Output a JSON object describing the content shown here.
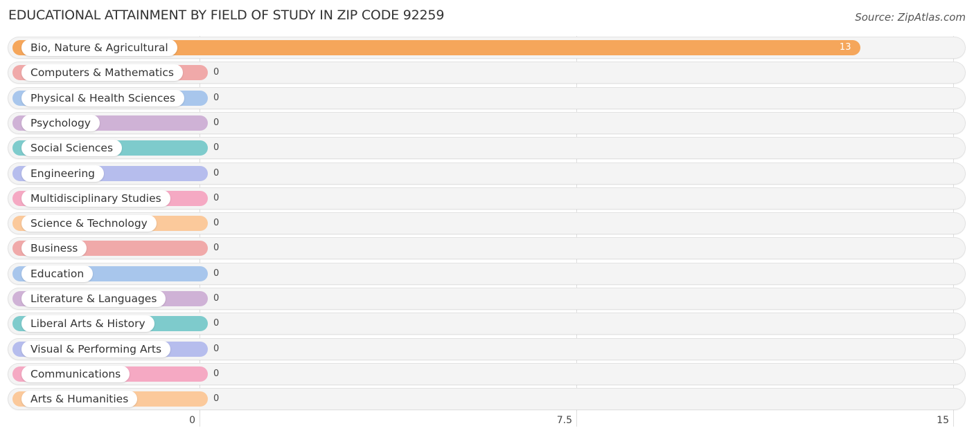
{
  "header": {
    "title": "EDUCATIONAL ATTAINMENT BY FIELD OF STUDY IN ZIP CODE 92259",
    "source": "Source: ZipAtlas.com"
  },
  "chart_data": {
    "type": "bar",
    "orientation": "horizontal",
    "title": "EDUCATIONAL ATTAINMENT BY FIELD OF STUDY IN ZIP CODE 92259",
    "xlabel": "",
    "ylabel": "",
    "xlim": [
      0,
      15
    ],
    "xticks": [
      "0",
      "7.5",
      "15"
    ],
    "xtick_values": [
      0,
      7.5,
      15
    ],
    "grid": true,
    "categories": [
      "Bio, Nature & Agricultural",
      "Computers & Mathematics",
      "Physical & Health Sciences",
      "Psychology",
      "Social Sciences",
      "Engineering",
      "Multidisciplinary Studies",
      "Science & Technology",
      "Business",
      "Education",
      "Literature & Languages",
      "Liberal Arts & History",
      "Visual & Performing Arts",
      "Communications",
      "Arts & Humanities"
    ],
    "values": [
      13,
      0,
      0,
      0,
      0,
      0,
      0,
      0,
      0,
      0,
      0,
      0,
      0,
      0,
      0
    ],
    "value_labels": [
      "13",
      "0",
      "0",
      "0",
      "0",
      "0",
      "0",
      "0",
      "0",
      "0",
      "0",
      "0",
      "0",
      "0",
      "0"
    ],
    "colors": [
      "#f5a65b",
      "#f0a9a9",
      "#a8c6ec",
      "#cfb2d6",
      "#7ecbcc",
      "#b6bded",
      "#f5a9c3",
      "#fbc99b",
      "#f0a9a9",
      "#a8c6ec",
      "#cfb2d6",
      "#7ecbcc",
      "#b6bded",
      "#f5a9c3",
      "#fbc99b"
    ]
  }
}
